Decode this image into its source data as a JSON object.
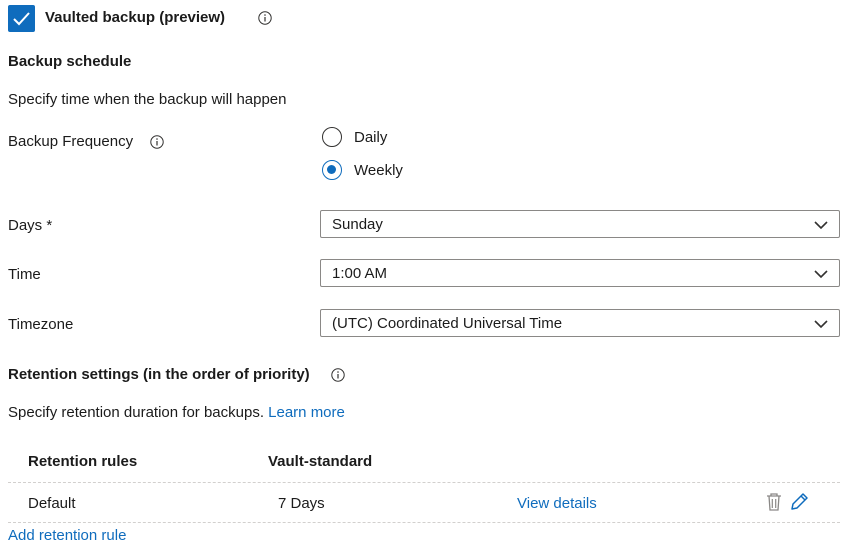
{
  "vaulted": {
    "label": "Vaulted backup (preview)",
    "checked": true
  },
  "schedule": {
    "heading": "Backup schedule",
    "description": "Specify time when the backup will happen",
    "frequency_label": "Backup Frequency",
    "options": [
      {
        "label": "Daily",
        "selected": false
      },
      {
        "label": "Weekly",
        "selected": true
      }
    ],
    "days_label": "Days *",
    "days_value": "Sunday",
    "time_label": "Time",
    "time_value": "1:00 AM",
    "timezone_label": "Timezone",
    "timezone_value": "(UTC) Coordinated Universal Time"
  },
  "retention": {
    "heading": "Retention settings (in the order of priority)",
    "description": "Specify retention duration for backups.",
    "learn_more": "Learn more",
    "columns": [
      "Retention rules",
      "Vault-standard"
    ],
    "rows": [
      {
        "rule": "Default",
        "vault_standard": "7 Days",
        "action": "View details"
      }
    ],
    "add_rule": "Add retention rule"
  },
  "colors": {
    "accent": "#0f6cbd",
    "text": "#1b1b1b",
    "border": "#8a8886"
  },
  "icons": [
    "checkmark-icon",
    "info-icon",
    "chevron-down-icon",
    "trash-icon",
    "edit-pencil-icon"
  ]
}
